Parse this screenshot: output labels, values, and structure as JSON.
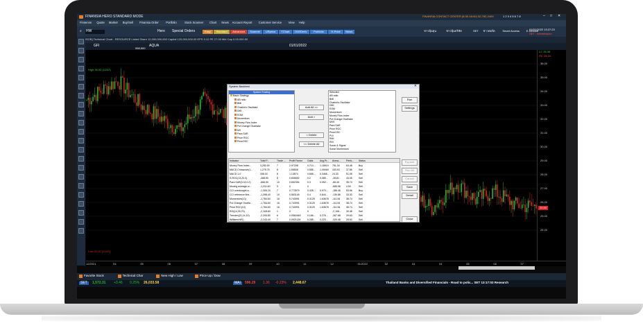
{
  "colors": {
    "up": "#1fbf2e",
    "down": "#e02020",
    "accent": "#3b86ff",
    "bg": "#000000"
  },
  "titlebar": {
    "app": "FINANSIA  HERO  STANDARD MODE",
    "contact": "FINANSIA  CONTACT CENTER (8:30-18:00) 02-782-2400",
    "pages": "1 2 3 4 5 6 7 8"
  },
  "menu": [
    "Finsenns",
    "Quote",
    "Market",
    "Buy/Sell",
    "Finansia Order",
    "Portfolio",
    "Stock Scanner",
    "Chart",
    "News",
    "Account Report",
    "Customer Service",
    "View",
    "Help"
  ],
  "toolbar": {
    "symbol": "HW",
    "mode": "Hero",
    "special": "Special Orders",
    "buttons": [
      "Easy",
      "Standard",
      "Advanced",
      "Scanner",
      "URprice",
      "TChart",
      "DW/Deriv",
      "Portfolio",
      "H-Price",
      "News"
    ],
    "links": [
      "ข่าวหุ้นทุน",
      "ข่าวหุ้นบริษัท",
      "SET",
      "ข่าวพอร์ต",
      "Smart Access",
      "E-Service"
    ],
    "datetime": "01/01/2022  13:27:23",
    "set_status": "SET : Intermission"
  },
  "chart_header": {
    "title": "[RSOB] Technical Chart - RESOURCE Listed Share 12,000,000,000 Capital 120,000,000.00 EPS 0.12 PE 27.00 Mkt Cap 0.00.000.00",
    "symbol": "GFI",
    "interval": "D",
    "right_stock": "AQUA",
    "periods": [
      "1D",
      "1W",
      "1M",
      "3M",
      "6M",
      "1Y"
    ],
    "date": "01/01/2022",
    "last": "0.94",
    "volume": "958,500",
    "change_pct": "-1.69%",
    "change_val": "0.01%",
    "best": "24.32",
    "best_price": "Best Price",
    "bid": "25.50",
    "ask": "25.75",
    "ind_high": "25.50",
    "ind_low": "25.75",
    "high_label": "High 36.50 (11/02)",
    "low_label": "Low 22.10 (11/02)"
  },
  "chart_data": {
    "type": "candlestick",
    "x_ticks": [
      "12/2021",
      "04",
      "05",
      "06",
      "07",
      "08",
      "09",
      "10",
      "11",
      "12",
      "01/2022",
      "02",
      "03",
      "04",
      "05",
      "06",
      "07"
    ],
    "y_ticks": [
      "36.00",
      "35.00",
      "34.00",
      "33.00",
      "32.00",
      "31.00",
      "30.00",
      "29.00",
      "28.00",
      "27.00",
      "26.00",
      "25.00",
      "24.00"
    ],
    "ylim": [
      21.5,
      36.7
    ],
    "last_price": "25.50",
    "price_tags": [
      "LC 35.38",
      "HC 25.18"
    ],
    "series_start": 33.4,
    "series_end": 25.7
  },
  "dialog": {
    "title": "System Backtest",
    "list_header": "System Trading",
    "selected_header": "Selected",
    "available": [
      "Basic Strategy",
      "AB ratio",
      "BMI",
      "Chaikin's Oscillator",
      "DMI",
      "EOM",
      "Momentum",
      "Money Flow Index",
      "Pct Change Oscillator",
      "MV",
      "Para SAR",
      "Price ROC",
      "PriceOSC"
    ],
    "selected": [
      "AB ratio",
      "BMI",
      "Chaikin's Oscillator",
      "DMI",
      "EOM",
      "Momentum",
      "Money Flow Index",
      "Pct Change Oscillator",
      "MVE",
      "Para SAR",
      "Price ROC",
      "PriceOSC",
      "PVI",
      "RMI",
      "RSI",
      "Sonar & Signal",
      "Sonar Momentum"
    ],
    "buttons": {
      "add_all": "Add All >>",
      "add": "Add >",
      "delete": "< Delete",
      "delete_all": "<< Delete All",
      "run": "Run",
      "settings": "Settings",
      "save": "Save",
      "detail": "Detail",
      "close": "Close",
      "expand": "Expand",
      "run_all": "Run All",
      "cancel": "Cancel"
    },
    "columns": [
      "Indicator",
      "Total P...",
      "Trade ...",
      "Profit Factor",
      "Odds",
      "Avg.Pr...",
      "Avera...",
      "Perfo...",
      "Status"
    ],
    "rows": [
      [
        "Money Flow Index...",
        "3,250.00",
        "7",
        "2.97298",
        "0.714...",
        "1.18919",
        "751.34",
        "63.48",
        "Buy"
      ],
      [
        "MACD Crossover(1...",
        "1,275.75",
        "8",
        "1.55508",
        "0.555...",
        "1.09069",
        "153.93",
        "37.86",
        "Sell"
      ],
      [
        "MACD 1-0",
        "336.00",
        "8",
        "1.13574",
        "0.666...",
        "0.3465...",
        "24.33",
        "51.05",
        "Sell"
      ],
      [
        "S-ROC(13,20,0)",
        "-468.50",
        "8",
        "0.835592",
        "0.2",
        "0.085...",
        "-28.81",
        "43.05",
        "Sell"
      ],
      [
        "Para SAR(0.02,0.2)",
        "-666.50",
        "10",
        "0.652394",
        "0.3",
        "0.052...",
        "-68.45",
        "35.74",
        "Sell"
      ],
      [
        "Moving average cr...",
        "-1,211.60",
        "3",
        "0",
        "0",
        "",
        "-685.58",
        "4.50",
        "Sell"
      ],
      [
        "CCI overbought a...",
        "-1,305.20",
        "7",
        "0.773579",
        "0.428...",
        "0.970...",
        "-186.46",
        "53.56",
        "Buy"
      ],
      [
        "CCI reference line...",
        "-1,398.40",
        "10",
        "0.563149",
        "0.4",
        "0.844...",
        "-139.86",
        "33.33",
        "Sell"
      ],
      [
        "Momentum(10)",
        "-1,784.60",
        "16",
        "0.743991",
        "0.3125",
        "1.63678",
        "-111.54",
        "38.74",
        "Sell"
      ],
      [
        "Pct Change Oscilla...",
        "-1,784.60",
        "16",
        "0.743991",
        "0.3125",
        "1.63678",
        "-111.54",
        "38.74",
        "Sell"
      ],
      [
        "Price ROC(10)",
        "-1,784.60",
        "16",
        "0.743991",
        "0.3125",
        "1.63678",
        "-111.54",
        "38.74",
        "Sell"
      ],
      [
        "RSI(14,30,70)",
        "-2,108.60",
        "1",
        "0",
        "0",
        "",
        "-2,108...",
        "30.48",
        "Sell"
      ],
      [
        "Trendex(21,14,10)",
        "-2,205.80",
        "6",
        "0.0560463",
        "0.166...",
        "0.276...",
        "-367.68",
        "29.63",
        "Sell"
      ],
      [
        "Williams%R(...",
        "-2,243.40",
        "7",
        "0.0921128",
        "0.285...",
        "0.223...",
        "-320.48",
        "28.63",
        "Sell"
      ]
    ]
  },
  "tabs": [
    "Favorite Stock",
    "Technical Char",
    "New High / Low",
    "Price Up / Dow"
  ],
  "ticker": {
    "set_label": "SET",
    "set_value": "1,572.31",
    "set_change": "+3.46",
    "set_pct": "0.25%",
    "set_volume": "26,033.58",
    "mai_label": "MAI",
    "mai_value": "596.29",
    "mai_change": "1.36",
    "mai_pct": "-0.23%",
    "mai_volume": "2,448.67",
    "news": "Thailand Banks and Diversified Financials - Road to polic... SET 13:17:03 Research"
  }
}
